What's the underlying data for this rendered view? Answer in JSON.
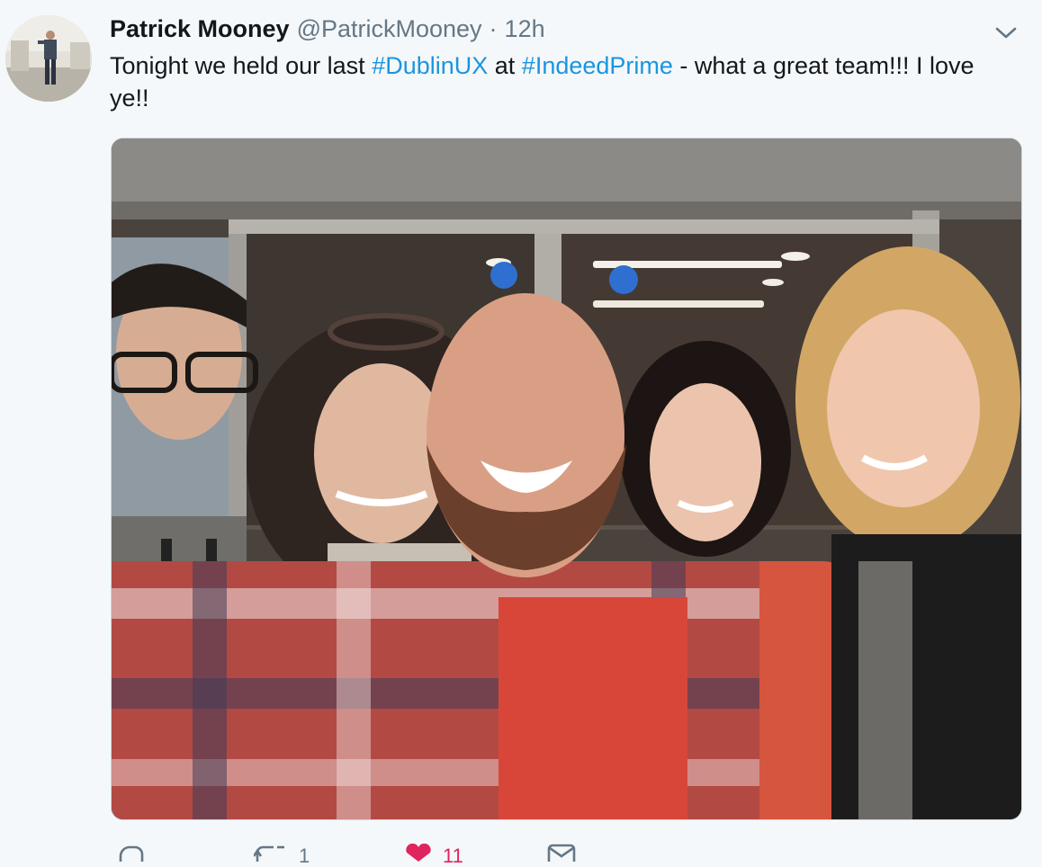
{
  "tweet": {
    "display_name": "Patrick Mooney",
    "handle": "@PatrickMooney",
    "separator": "·",
    "time": "12h",
    "text_parts": {
      "t1": "Tonight we held our last ",
      "h1": "#DublinUX",
      "t2": " at ",
      "h2": "#IndeedPrime",
      "t3": " - what a great team!!! I love ye!!"
    },
    "icons": {
      "caret": "chevron-down-icon",
      "reply": "reply-icon",
      "retweet": "retweet-icon",
      "like": "heart-icon",
      "dm": "envelope-icon"
    },
    "actions": {
      "reply_count": "",
      "retweet_count": "1",
      "like_count": "11"
    }
  },
  "colors": {
    "background": "#f5f8fa",
    "text": "#14171a",
    "secondary": "#657786",
    "hashtag": "#1b95e0",
    "like": "#e0245e"
  }
}
